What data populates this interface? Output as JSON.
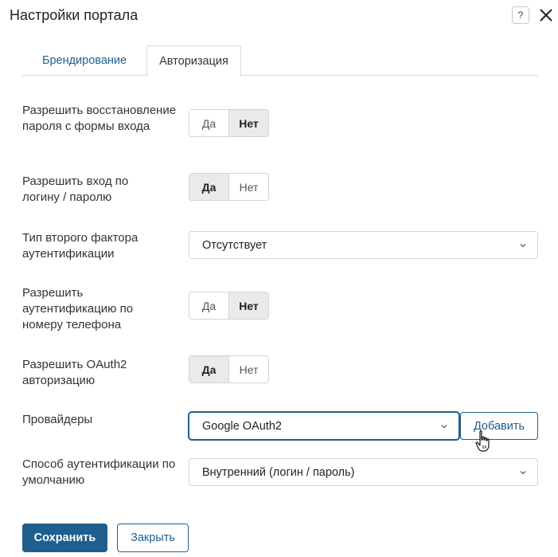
{
  "dialog": {
    "title": "Настройки портала",
    "help_label": "?",
    "close_icon": "close-icon"
  },
  "tabs": [
    {
      "label": "Брендирование",
      "active": false
    },
    {
      "label": "Авторизация",
      "active": true
    }
  ],
  "settings": {
    "password_recovery": {
      "label": "Разрешить восстановление пароля с формы входа",
      "yes": "Да",
      "no": "Нет",
      "selected": "Нет"
    },
    "login_password": {
      "label": "Разрешить вход по логину / паролю",
      "yes": "Да",
      "no": "Нет",
      "selected": "Да"
    },
    "second_factor": {
      "label": "Тип второго фактора аутентификации",
      "value": "Отсутствует"
    },
    "phone_auth": {
      "label": "Разрешить аутентификацию по номеру телефона",
      "yes": "Да",
      "no": "Нет",
      "selected": "Нет"
    },
    "oauth2": {
      "label": "Разрешить OAuth2 авторизацию",
      "yes": "Да",
      "no": "Нет",
      "selected": "Да"
    },
    "providers": {
      "label": "Провайдеры",
      "value": "Google OAuth2",
      "add_label": "Добавить"
    },
    "default_auth": {
      "label": "Способ аутентификации по умолчанию",
      "value": "Внутренний (логин / пароль)"
    }
  },
  "footer": {
    "save_label": "Сохранить",
    "close_label": "Закрыть"
  },
  "colors": {
    "accent": "#1e5f8f",
    "active_toggle_bg": "#eaeaea",
    "border": "#d4d4d4"
  }
}
